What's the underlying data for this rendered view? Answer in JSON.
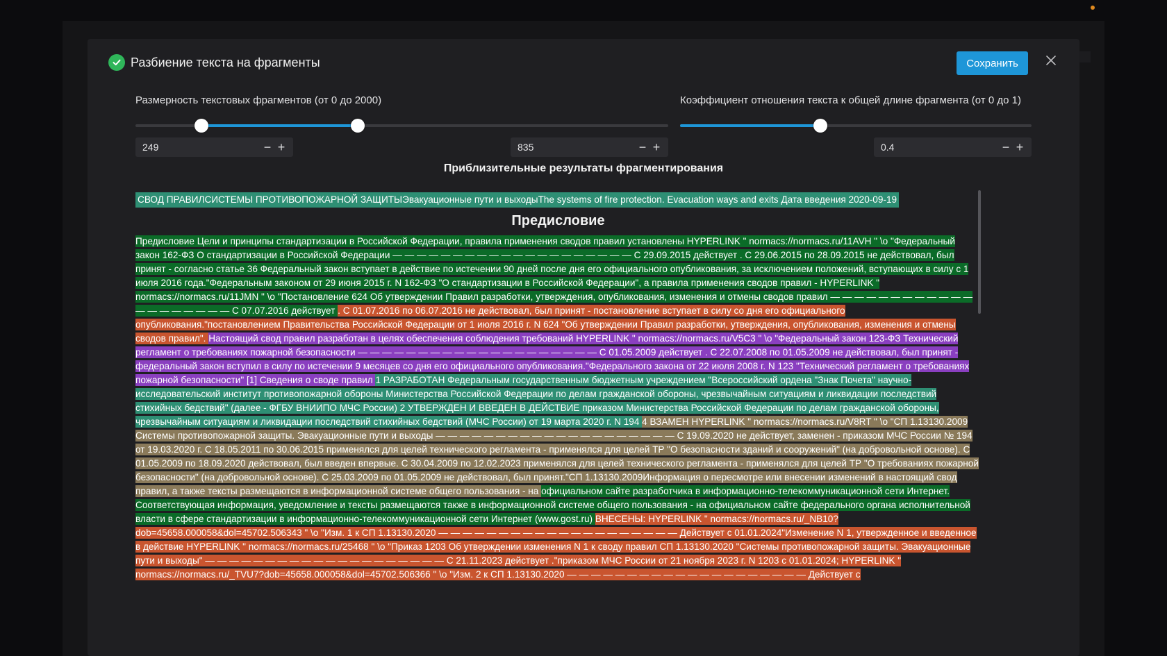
{
  "modal": {
    "title": "Разбиение текста на фрагменты",
    "save_label": "Сохранить",
    "close_icon": "close-icon",
    "check_icon": "check-circle-icon"
  },
  "size_slider": {
    "label": "Размерность текстовых фрагментов (от 0 до 2000)",
    "min_value": "249",
    "max_value": "835",
    "min_fraction": 0.1245,
    "max_fraction": 0.4175
  },
  "ratio_slider": {
    "label": "Коэффициент отношения текста к общей длине фрагмента (от 0 до 1)",
    "value": "0.4",
    "fraction": 0.4
  },
  "stepper": {
    "minus": "−",
    "plus": "+"
  },
  "results": {
    "title": "Приблизительные результаты фрагментирования",
    "first_line": "СВОД ПРАВИЛСИСТЕМЫ ПРОТИВОПОЖАРНОЙ ЗАЩИТЫЭвакуационные пути и выходыThe systems of fire protection. Evacuation ways and exits Дата введения 2020-09-19",
    "heading": "Предисловие",
    "fragments": [
      {
        "color": "green",
        "text": " Предисловие Цели и принципы стандартизации в Российской Федерации, правила применения сводов правил установлены HYPERLINK \" normacs://normacs.ru/11AVH \" \\o \"Федеральный закон 162-ФЗ О стандартизации в Российской Федерации — — — — — — — — — — — — — — — — — — — — С 29.09.2015 действует . С 29.06.2015 по 28.09.2015 не действовал, был принят - согласно статье 36 Федеральный закон вступает в действие по истечении 90 дней после дня его официального опубликования, за исключением положений, вступающих в силу с 1 июля 2016 года.\"Федеральным законом от 29 июня 2015 г. N 162-ФЗ \"О стандартизации в Российской Федерации\", а правила применения сводов правил - HYPERLINK \" normacs://normacs.ru/11JMN \" \\o \"Постановление 624 Об утверждении Правил разработки, утверждения, опубликования, изменения и отмены сводов правил — — — — — — — — — — — — — — — — — — — — С 07.07.2016 действует "
      },
      {
        "color": "orange",
        "text": ". С 01.07.2016 по 06.07.2016 не действовал, был принят - постановление вступает в силу со дня его официального опубликования.\"постановлением Правительства Российской Федерации от 1 июля 2016 г. N 624 \"Об утверждении Правил разработки, утверждения, опубликования, изменения и отмены сводов правил\". "
      },
      {
        "color": "purple",
        "text": "Настоящий свод правил разработан в целях обеспечения соблюдения требований HYPERLINK \" normacs://normacs.ru/V5C3 \" \\o \"Федеральный закон 123-ФЗ Технический регламент о требованиях пожарной безопасности — — — — — — — — — — — — — — — — — — — — С 01.05.2009 действует . С 22.07.2008 по 01.05.2009 не действовал, был принят - федеральный закон вступил в силу по истечении 9 месяцев со дня его официального опубликования.\"Федерального закона от 22 июля 2008 г. N 123 \"Технический регламент о требованиях пожарной безопасности\" [1] Сведения о своде правил  "
      },
      {
        "color": "teal",
        "text": " 1 РАЗРАБОТАН Федеральным государственным бюджетным учреждением \"Всероссийский ордена \"Знак Почета\" научно-исследовательский институт противопожарной обороны Министерства Российской Федерации по делам гражданской обороны, чрезвычайным ситуациям и ликвидации последствий стихийных бедствий\" (далее - ФГБУ ВНИИПО МЧС России)   2 УТВЕРЖДЕН И ВВЕДЕН В ДЕЙСТВИЕ приказом Министерства Российской Федерации по делам гражданской обороны, чрезвычайным ситуациям и ликвидации последствий стихийных бедствий (МЧС России) от 19 марта 2020 г.  N 194  "
      },
      {
        "color": "khaki",
        "text": " 4 ВЗАМЕН HYPERLINK \" normacs://normacs.ru/V8RT \" \\o \"СП 1.13130.2009 Системы противопожарной защиты. Эвакуационные пути и выходы — — — — — — — — — — — — — — — — — — — — С 19.09.2020 не действует, заменен - приказом МЧС России № 194 от 19.03.2020 г. С 18.05.2011 по 30.06.2015 применялся для целей технического регламента - применялся для целей ТР \"О безопасности зданий и сооружений\" (на добровольной основе). С 01.05.2009 по 18.09.2020 действовал, был введен впервые. С 30.04.2009 по 12.02.2023 применялся для целей технического регламента - применялся для целей ТР \"О требованиях пожарной безопасности\" (на добровольной основе). С 25.03.2009 по 01.05.2009 не действовал, был принят.\"СП 1.13130.2009Информация о пересмотре или внесении изменений в настоящий свод правил, а также тексты размещаются в информационной системе общего пользования - на "
      },
      {
        "color": "green",
        "text": "официальном сайте разработчика в информационно-телекоммуникационной сети Интернет. Соответствующая информация, уведомление и тексты размещаются также в информационной системе общего пользования - на официальном сайте федерального органа исполнительной власти в сфере стандартизации в информационно-телекоммуникационной сети Интернет (www.gost.ru) "
      },
      {
        "color": "orange",
        "text": "ВНЕСЕНЫ: HYPERLINK \" normacs://normacs.ru/_NB10?dob=45658.000058&dol=45702.506343 \" \\o \"Изм. 1 к СП 1.13130.2020 — — — — — — — — — — — — — — — — — — — — Действует с 01.01.2024\"Изменение N 1, утвержденное и введенное в действие HYPERLINK \" normacs://normacs.ru/25468 \" \\o \"Приказ 1203 Об утверждении изменения N 1 к своду правил СП 1.13130.2020 \"Системы противопожарной защиты. Эвакуационные пути и выходы\" — — — — — — — — — — — — — — — — — — — — С 21.11.2023 действует .\"приказом МЧС России от 21 ноября 2023 г. N 1203 с 01.01.2024; HYPERLINK \" normacs://normacs.ru/_TVU7?dob=45658.000058&dol=45702.506366 \" \\o \"Изм. 2 к СП 1.13130.2020 — — — — — — — — — — — — — — — — — — — — Действует с "
      }
    ],
    "colors": {
      "green": "#0b6b28",
      "orange": "#c9552f",
      "purple": "#8a3fc0",
      "teal": "#2e8f74",
      "khaki": "#8a7a5a"
    }
  },
  "accent_color": "#1e96d8"
}
